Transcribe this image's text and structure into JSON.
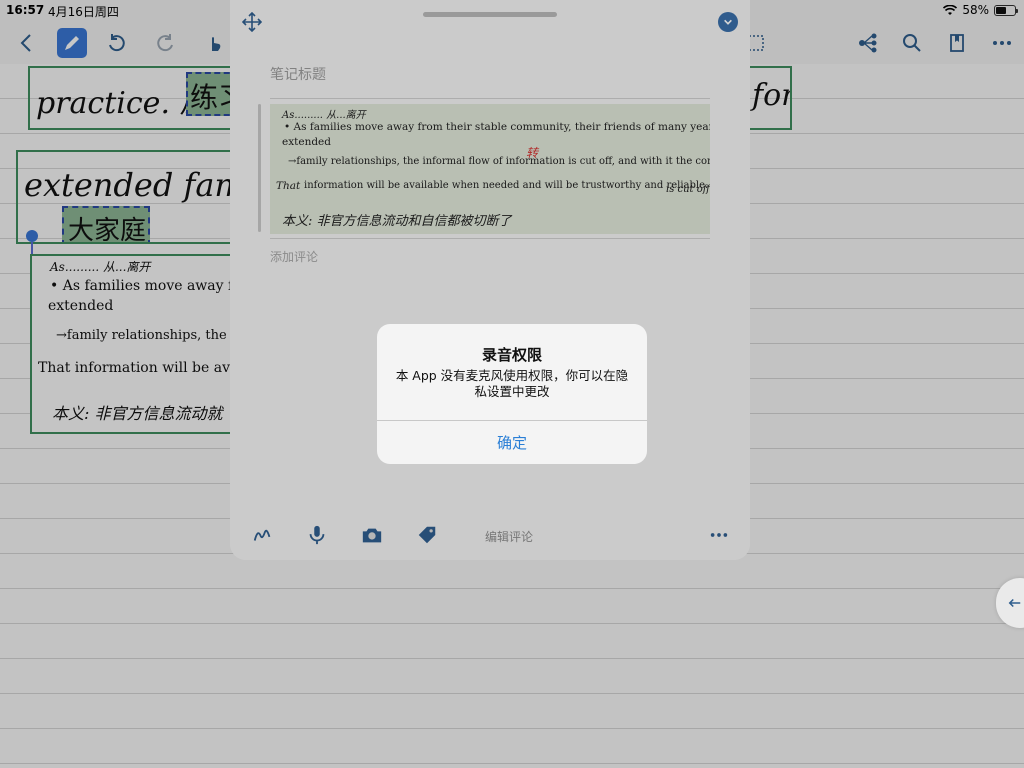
{
  "status_bar": {
    "time": "16:57",
    "date": "4月16日周四",
    "battery": "58%",
    "battery_level": 0.58
  },
  "toolbar": {
    "left_icons": [
      "back-icon",
      "pen-icon",
      "undo-icon",
      "redo-icon",
      "hand-icon"
    ],
    "right_icons": [
      "mind-map-icon",
      "search-icon",
      "bookmark-icon",
      "more-icon"
    ]
  },
  "background_cards": {
    "card1_text": "practice. 原",
    "card1_tag": "练习",
    "card1_right": "for",
    "card2_text": "extended famil",
    "card2_tag": "大家庭",
    "card3_lines": [
      "As......... 从...离开",
      "• As families move away fr",
      "extended",
      "→family relationships, the i",
      "That information will be availa",
      "本义: 非官方信息流动就"
    ]
  },
  "note_panel": {
    "title_placeholder": "笔记标题",
    "snippet": {
      "line1": "As......... 从...离开",
      "line2": "• As families move away from their stable community, their friends of many years, their",
      "line3": "extended",
      "line4": "→family relationships, the informal flow of information is cut off, and with it the confidence",
      "line5_prefix": "That",
      "line5": "information will be available when needed and will be trustworthy and reliable.",
      "line5_suffix": "is cut off",
      "annotation": "转",
      "line6": "本义: 非官方信息流动和自信都被切断了"
    },
    "comment_placeholder": "添加评论",
    "bottom_label": "编辑评论",
    "bottom_icons": [
      "handwriting-icon",
      "microphone-icon",
      "camera-icon",
      "tag-icon",
      "more-icon"
    ]
  },
  "alert": {
    "title": "录音权限",
    "message": "本 App 没有麦克风使用权限，你可以在隐私设置中更改",
    "button": "确定"
  }
}
